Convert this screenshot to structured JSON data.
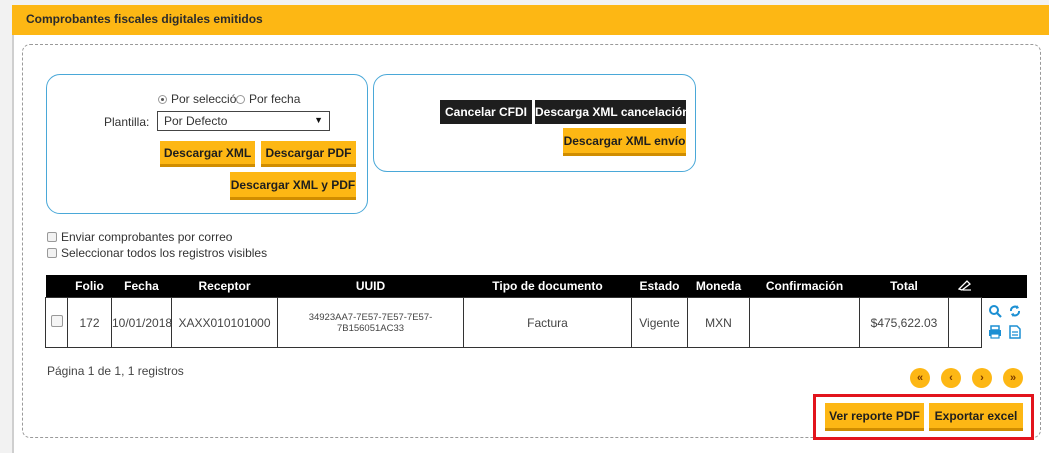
{
  "header": {
    "title": "Comprobantes fiscales digitales emitidos"
  },
  "filters": {
    "radio_options": [
      "Por selección",
      "Por fecha"
    ],
    "selected_radio": "Por selección",
    "template_label": "Plantilla:",
    "template_value": "Por Defecto",
    "download_xml": "Descargar XML",
    "download_pdf": "Descargar PDF",
    "download_xml_pdf": "Descargar XML y PDF"
  },
  "actions": {
    "cancel_cfdi": "Cancelar CFDI",
    "download_xml_cancel": "Descarga XML cancelación",
    "download_xml_send": "Descargar XML envío"
  },
  "options": {
    "send_email": "Enviar comprobantes por correo",
    "select_all": "Seleccionar todos los registros visibles"
  },
  "table": {
    "headers": [
      "",
      "Folio",
      "Fecha",
      "Receptor",
      "UUID",
      "Tipo de documento",
      "Estado",
      "Moneda",
      "Confirmación",
      "Total",
      ""
    ],
    "rows": [
      {
        "folio": "172",
        "fecha": "10/01/2018",
        "receptor": "XAXX010101000",
        "uuid": "34923AA7-7E57-7E57-7E57-7B156051AC33",
        "tipo": "Factura",
        "estado": "Vigente",
        "moneda": "MXN",
        "confirmacion": "",
        "total": "$475,622.03"
      }
    ]
  },
  "pager": {
    "text": "Página 1 de 1, 1 registros",
    "first": "«",
    "prev": "‹",
    "next": "›",
    "last": "»"
  },
  "footer": {
    "report_pdf": "Ver reporte PDF",
    "export_excel": "Exportar excel"
  },
  "colors": {
    "accent": "#fdb714",
    "panel_border": "#4aa8d8",
    "highlight": "#e2141c"
  }
}
